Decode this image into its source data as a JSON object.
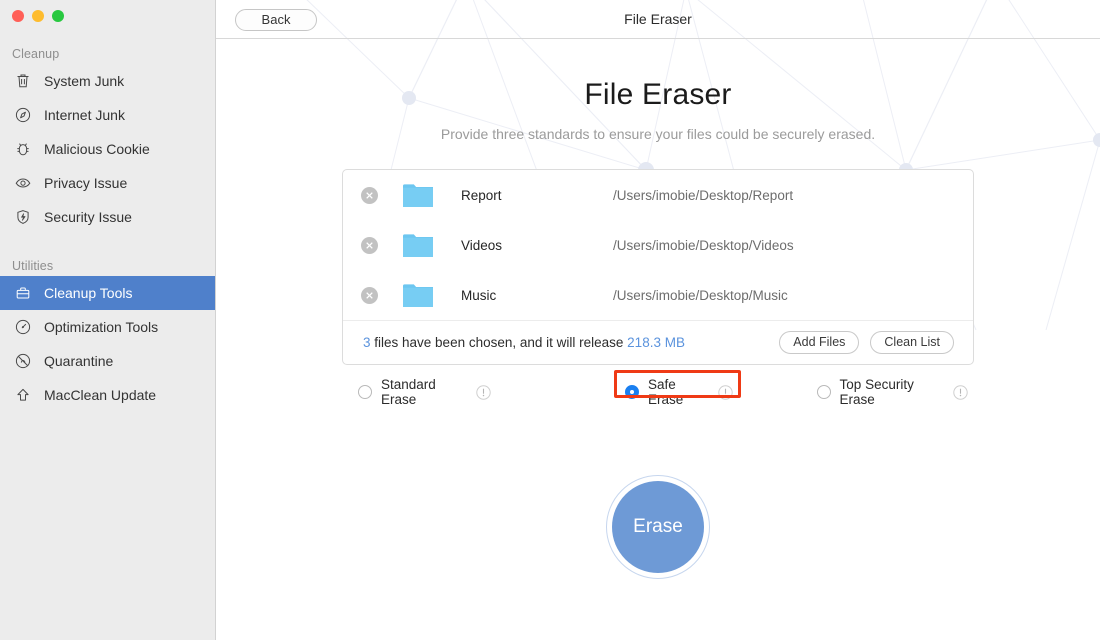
{
  "window": {
    "title": "File Eraser",
    "back_label": "Back",
    "traffic_lights": [
      "close-red",
      "minimize-yellow",
      "zoom-green"
    ]
  },
  "sidebar": {
    "groups": [
      {
        "label": "Cleanup",
        "items": [
          {
            "label": "System Junk",
            "icon": "trash-icon",
            "active": false
          },
          {
            "label": "Internet Junk",
            "icon": "compass-icon",
            "active": false
          },
          {
            "label": "Malicious Cookie",
            "icon": "bug-icon",
            "active": false
          },
          {
            "label": "Privacy Issue",
            "icon": "eye-icon",
            "active": false
          },
          {
            "label": "Security Issue",
            "icon": "shield-bolt-icon",
            "active": false
          }
        ]
      },
      {
        "label": "Utilities",
        "items": [
          {
            "label": "Cleanup Tools",
            "icon": "briefcase-icon",
            "active": true
          },
          {
            "label": "Optimization Tools",
            "icon": "gauge-icon",
            "active": false
          },
          {
            "label": "Quarantine",
            "icon": "no-entry-icon",
            "active": false
          },
          {
            "label": "MacClean Update",
            "icon": "up-arrow-icon",
            "active": false
          }
        ]
      }
    ]
  },
  "page": {
    "title": "File Eraser",
    "subtitle": "Provide three standards to ensure your files could be securely erased."
  },
  "file_panel": {
    "rows": [
      {
        "name": "Report",
        "path": "/Users/imobie/Desktop/Report",
        "icon": "folder-icon",
        "delete_icon": "remove-circle-icon"
      },
      {
        "name": "Videos",
        "path": "/Users/imobie/Desktop/Videos",
        "icon": "folder-icon",
        "delete_icon": "remove-circle-icon"
      },
      {
        "name": "Music",
        "path": "/Users/imobie/Desktop/Music",
        "icon": "folder-icon",
        "delete_icon": "remove-circle-icon"
      }
    ],
    "status": {
      "count": "3",
      "mid_text": " files have been chosen, and it will release ",
      "size": "218.3 MB"
    },
    "add_files_label": "Add Files",
    "clean_list_label": "Clean List"
  },
  "erase_options": {
    "selected": "Safe Erase",
    "items": [
      {
        "label": "Standard Erase",
        "selected": false,
        "info_icon": "info-circle-icon"
      },
      {
        "label": "Safe Erase",
        "selected": true,
        "info_icon": "info-circle-icon"
      },
      {
        "label": "Top Security Erase",
        "selected": false,
        "info_icon": "info-circle-icon"
      }
    ],
    "highlight": {
      "target": "Safe Erase",
      "color": "#ef3a15"
    }
  },
  "action": {
    "erase_label": "Erase"
  },
  "colors": {
    "accent_blue": "#5b93dd",
    "sidebar_active": "#4f80cb",
    "radio_on": "#1a7ff0",
    "erase_button": "#6e9ad6",
    "highlight_red": "#ef3a15",
    "folder_blue": "#6cc6f0"
  }
}
